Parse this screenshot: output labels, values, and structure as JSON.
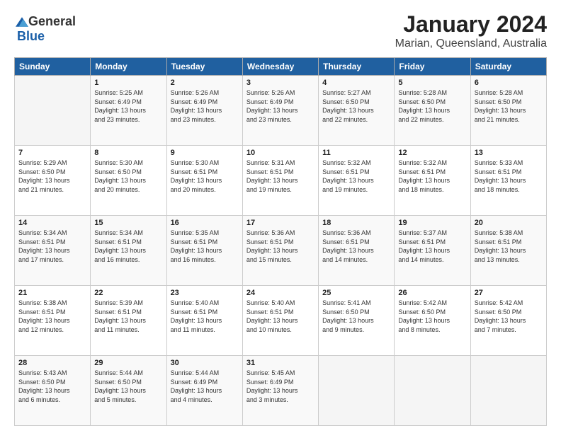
{
  "header": {
    "logo_general": "General",
    "logo_blue": "Blue",
    "title": "January 2024",
    "subtitle": "Marian, Queensland, Australia"
  },
  "days_of_week": [
    "Sunday",
    "Monday",
    "Tuesday",
    "Wednesday",
    "Thursday",
    "Friday",
    "Saturday"
  ],
  "weeks": [
    [
      {
        "day": "",
        "info": ""
      },
      {
        "day": "1",
        "info": "Sunrise: 5:25 AM\nSunset: 6:49 PM\nDaylight: 13 hours\nand 23 minutes."
      },
      {
        "day": "2",
        "info": "Sunrise: 5:26 AM\nSunset: 6:49 PM\nDaylight: 13 hours\nand 23 minutes."
      },
      {
        "day": "3",
        "info": "Sunrise: 5:26 AM\nSunset: 6:49 PM\nDaylight: 13 hours\nand 23 minutes."
      },
      {
        "day": "4",
        "info": "Sunrise: 5:27 AM\nSunset: 6:50 PM\nDaylight: 13 hours\nand 22 minutes."
      },
      {
        "day": "5",
        "info": "Sunrise: 5:28 AM\nSunset: 6:50 PM\nDaylight: 13 hours\nand 22 minutes."
      },
      {
        "day": "6",
        "info": "Sunrise: 5:28 AM\nSunset: 6:50 PM\nDaylight: 13 hours\nand 21 minutes."
      }
    ],
    [
      {
        "day": "7",
        "info": "Sunrise: 5:29 AM\nSunset: 6:50 PM\nDaylight: 13 hours\nand 21 minutes."
      },
      {
        "day": "8",
        "info": "Sunrise: 5:30 AM\nSunset: 6:50 PM\nDaylight: 13 hours\nand 20 minutes."
      },
      {
        "day": "9",
        "info": "Sunrise: 5:30 AM\nSunset: 6:51 PM\nDaylight: 13 hours\nand 20 minutes."
      },
      {
        "day": "10",
        "info": "Sunrise: 5:31 AM\nSunset: 6:51 PM\nDaylight: 13 hours\nand 19 minutes."
      },
      {
        "day": "11",
        "info": "Sunrise: 5:32 AM\nSunset: 6:51 PM\nDaylight: 13 hours\nand 19 minutes."
      },
      {
        "day": "12",
        "info": "Sunrise: 5:32 AM\nSunset: 6:51 PM\nDaylight: 13 hours\nand 18 minutes."
      },
      {
        "day": "13",
        "info": "Sunrise: 5:33 AM\nSunset: 6:51 PM\nDaylight: 13 hours\nand 18 minutes."
      }
    ],
    [
      {
        "day": "14",
        "info": "Sunrise: 5:34 AM\nSunset: 6:51 PM\nDaylight: 13 hours\nand 17 minutes."
      },
      {
        "day": "15",
        "info": "Sunrise: 5:34 AM\nSunset: 6:51 PM\nDaylight: 13 hours\nand 16 minutes."
      },
      {
        "day": "16",
        "info": "Sunrise: 5:35 AM\nSunset: 6:51 PM\nDaylight: 13 hours\nand 16 minutes."
      },
      {
        "day": "17",
        "info": "Sunrise: 5:36 AM\nSunset: 6:51 PM\nDaylight: 13 hours\nand 15 minutes."
      },
      {
        "day": "18",
        "info": "Sunrise: 5:36 AM\nSunset: 6:51 PM\nDaylight: 13 hours\nand 14 minutes."
      },
      {
        "day": "19",
        "info": "Sunrise: 5:37 AM\nSunset: 6:51 PM\nDaylight: 13 hours\nand 14 minutes."
      },
      {
        "day": "20",
        "info": "Sunrise: 5:38 AM\nSunset: 6:51 PM\nDaylight: 13 hours\nand 13 minutes."
      }
    ],
    [
      {
        "day": "21",
        "info": "Sunrise: 5:38 AM\nSunset: 6:51 PM\nDaylight: 13 hours\nand 12 minutes."
      },
      {
        "day": "22",
        "info": "Sunrise: 5:39 AM\nSunset: 6:51 PM\nDaylight: 13 hours\nand 11 minutes."
      },
      {
        "day": "23",
        "info": "Sunrise: 5:40 AM\nSunset: 6:51 PM\nDaylight: 13 hours\nand 11 minutes."
      },
      {
        "day": "24",
        "info": "Sunrise: 5:40 AM\nSunset: 6:51 PM\nDaylight: 13 hours\nand 10 minutes."
      },
      {
        "day": "25",
        "info": "Sunrise: 5:41 AM\nSunset: 6:50 PM\nDaylight: 13 hours\nand 9 minutes."
      },
      {
        "day": "26",
        "info": "Sunrise: 5:42 AM\nSunset: 6:50 PM\nDaylight: 13 hours\nand 8 minutes."
      },
      {
        "day": "27",
        "info": "Sunrise: 5:42 AM\nSunset: 6:50 PM\nDaylight: 13 hours\nand 7 minutes."
      }
    ],
    [
      {
        "day": "28",
        "info": "Sunrise: 5:43 AM\nSunset: 6:50 PM\nDaylight: 13 hours\nand 6 minutes."
      },
      {
        "day": "29",
        "info": "Sunrise: 5:44 AM\nSunset: 6:50 PM\nDaylight: 13 hours\nand 5 minutes."
      },
      {
        "day": "30",
        "info": "Sunrise: 5:44 AM\nSunset: 6:49 PM\nDaylight: 13 hours\nand 4 minutes."
      },
      {
        "day": "31",
        "info": "Sunrise: 5:45 AM\nSunset: 6:49 PM\nDaylight: 13 hours\nand 3 minutes."
      },
      {
        "day": "",
        "info": ""
      },
      {
        "day": "",
        "info": ""
      },
      {
        "day": "",
        "info": ""
      }
    ]
  ]
}
